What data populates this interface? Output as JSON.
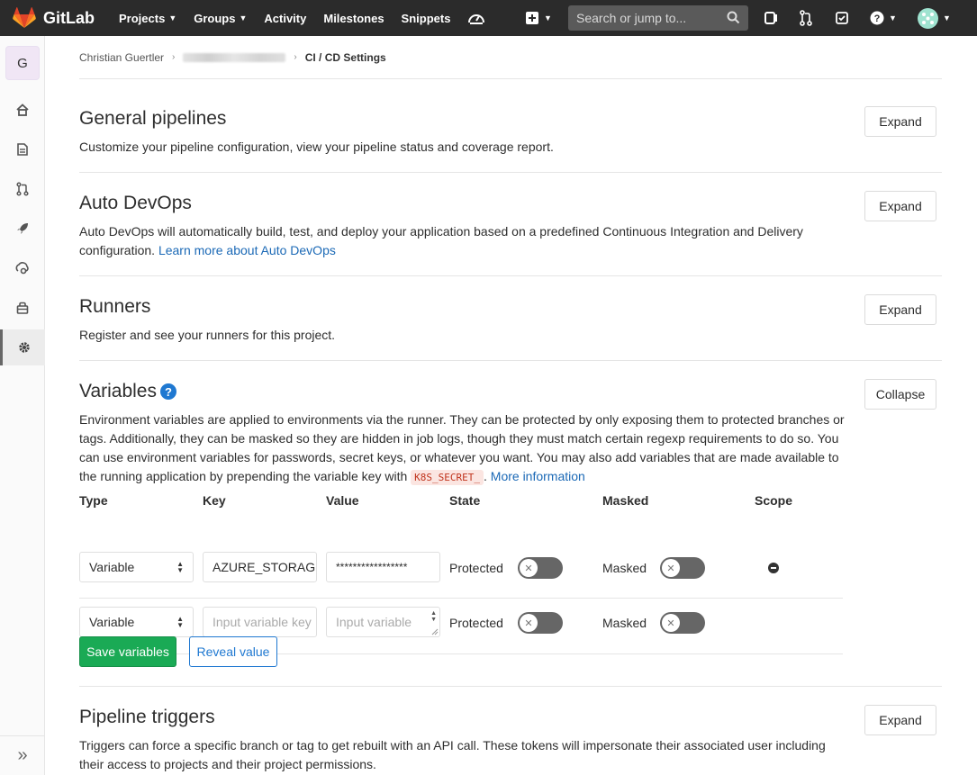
{
  "navbar": {
    "brand": "GitLab",
    "links": [
      {
        "label": "Projects",
        "has_caret": true
      },
      {
        "label": "Groups",
        "has_caret": true
      },
      {
        "label": "Activity",
        "has_caret": false
      },
      {
        "label": "Milestones",
        "has_caret": false
      },
      {
        "label": "Snippets",
        "has_caret": false
      }
    ],
    "search_placeholder": "Search or jump to...",
    "icons": [
      "speedometer-icon",
      "plus-square-icon",
      "issues-icon",
      "merge-request-icon",
      "todo-icon",
      "help-icon",
      "user-avatar"
    ]
  },
  "sidebar": {
    "project_letter": "G",
    "items": [
      "home-icon",
      "repository-icon",
      "merge-requests-icon",
      "ci-cd-icon",
      "operations-icon",
      "packages-icon",
      "settings-icon"
    ],
    "collapse_glyph": "»"
  },
  "breadcrumb": {
    "owner": "Christian Guertler",
    "current": "CI / CD Settings"
  },
  "sections": {
    "general": {
      "title": "General pipelines",
      "description": "Customize your pipeline configuration, view your pipeline status and coverage report.",
      "button": "Expand"
    },
    "autodevops": {
      "title": "Auto DevOps",
      "description": "Auto DevOps will automatically build, test, and deploy your application based on a predefined Continuous Integration and Delivery configuration.",
      "link": "Learn more about Auto DevOps",
      "button": "Expand"
    },
    "runners": {
      "title": "Runners",
      "description": "Register and see your runners for this project.",
      "button": "Expand"
    },
    "variables": {
      "title": "Variables",
      "description": "Environment variables are applied to environments via the runner. They can be protected by only exposing them to protected branches or tags. Additionally, they can be masked so they are hidden in job logs, though they must match certain regexp requirements to do so. You can use environment variables for passwords, secret keys, or whatever you want. You may also add variables that are made available to the running application by prepending the variable key with",
      "code": "K8S_SECRET_",
      "link": "More information",
      "button": "Collapse",
      "columns": {
        "type": "Type",
        "key": "Key",
        "value": "Value",
        "state": "State",
        "masked": "Masked",
        "scope": "Scope"
      },
      "rows": [
        {
          "type": "Variable",
          "key": "AZURE_STORAGE",
          "value": "*****************",
          "state": "Protected",
          "masked": "Masked"
        },
        {
          "type": "Variable",
          "key_placeholder": "Input variable key",
          "value_placeholder": "Input variable",
          "state": "Protected",
          "masked": "Masked"
        }
      ],
      "save_button": "Save variables",
      "reveal_button": "Reveal value"
    },
    "triggers": {
      "title": "Pipeline triggers",
      "description": "Triggers can force a specific branch or tag to get rebuilt with an API call. These tokens will impersonate their associated user including their access to projects and their project permissions.",
      "button": "Expand"
    }
  },
  "colors": {
    "navbar_bg": "#2b2b2b",
    "primary_link": "#1b69b6",
    "success": "#1aaa55",
    "toggle_off": "#666666"
  }
}
